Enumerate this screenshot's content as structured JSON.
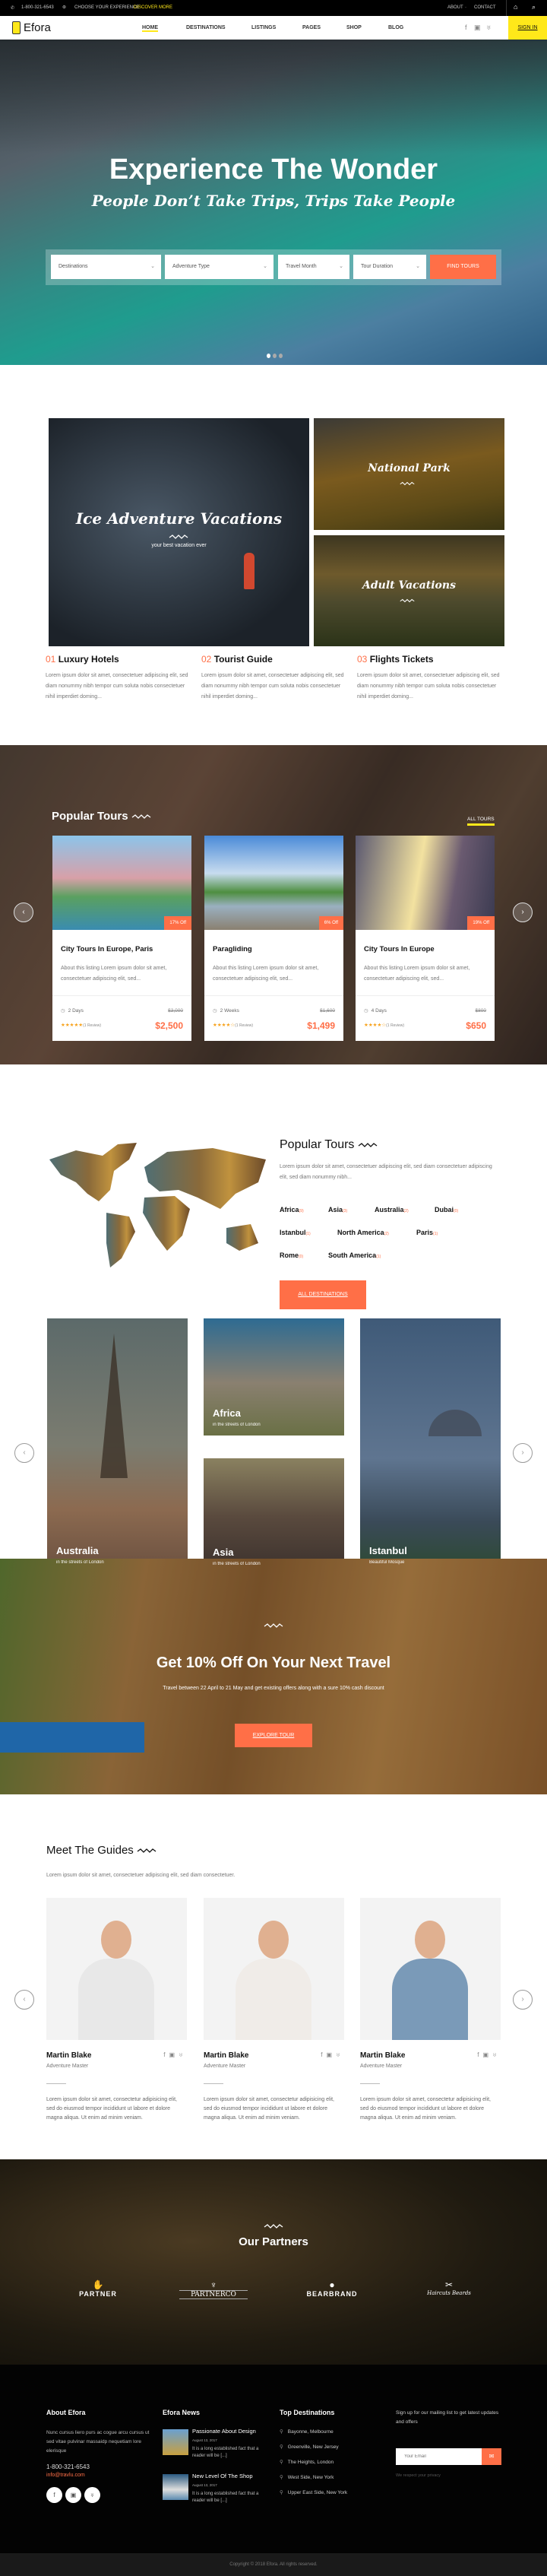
{
  "topbar": {
    "phone": "1-800-321-6543",
    "experience": "CHOOSE YOUR EXPERIENCE",
    "discover": "DISCOVER MORE",
    "about": "ABOUT",
    "contact": "CONTACT"
  },
  "nav": {
    "logo": "Efora",
    "items": [
      "HOME",
      "DESTINATIONS",
      "LISTINGS",
      "PAGES",
      "SHOP",
      "BLOG"
    ],
    "active": "HOME",
    "sign_in": "SIGN IN"
  },
  "hero": {
    "title": "Experience The Wonder",
    "subtitle": "People Don’t Take Trips, Trips Take People",
    "search": {
      "destinations": "Destinations",
      "adventure": "Adventure Type",
      "month": "Travel Month",
      "duration": "Tour Duration",
      "button": "FIND TOURS"
    },
    "slides": 3,
    "active_slide": 1
  },
  "categories": [
    {
      "title": "Ice Adventure Vacations",
      "subtitle": "your best vacation ever"
    },
    {
      "title": "National Park"
    },
    {
      "title": "Adult Vacations"
    }
  ],
  "features": [
    {
      "num": "01",
      "title": "Luxury Hotels",
      "text": "Lorem ipsum dolor sit amet, consectetuer adipiscing elit, sed diam nonummy nibh tempor cum soluta nobis consectetuer nihil imperdiet doming..."
    },
    {
      "num": "02",
      "title": "Tourist Guide",
      "text": "Lorem ipsum dolor sit amet, consectetuer adipiscing elit, sed diam nonummy nibh tempor cum soluta nobis consectetuer nihil imperdiet doming..."
    },
    {
      "num": "03",
      "title": "Flights Tickets",
      "text": "Lorem ipsum dolor sit amet, consectetuer adipiscing elit, sed diam nonummy nibh tempor cum soluta nobis consectetuer nihil imperdiet doming..."
    }
  ],
  "tours": {
    "title": "Popular Tours",
    "all": "ALL TOURS",
    "items": [
      {
        "discount": "17% Off",
        "title": "City Tours In Europe, Paris",
        "desc": "About this listing Lorem ipsum dolor sit amet, consectetuer adipiscing elit, sed...",
        "duration": "2 Days",
        "rating": 5,
        "reviews": "(1 Review)",
        "old_price": "$3,000",
        "price": "$2,500"
      },
      {
        "discount": "6% Off",
        "title": "Paragliding",
        "desc": "About this listing Lorem ipsum dolor sit amet, consectetuer adipiscing elit, sed...",
        "duration": "2 Weeks",
        "rating": 4,
        "reviews": "(1 Review)",
        "old_price": "$1,600",
        "price": "$1,499"
      },
      {
        "discount": "19% Off",
        "title": "City Tours In Europe",
        "desc": "About this listing Lorem ipsum dolor sit amet, consectetuer adipiscing elit, sed...",
        "duration": "4 Days",
        "rating": 4,
        "reviews": "(1 Review)",
        "old_price": "$800",
        "price": "$650"
      }
    ]
  },
  "map_tours": {
    "title": "Popular Tours",
    "text": "Lorem ipsum dolor sit amet, consectetuer adipiscing elit, sed diam consectetuer adipiscing elit, sed diam nonummy nibh...",
    "destinations": [
      {
        "name": "Africa",
        "count": "(9)"
      },
      {
        "name": "Asia",
        "count": "(3)"
      },
      {
        "name": "Australia",
        "count": "(2)"
      },
      {
        "name": "Dubai",
        "count": "(0)"
      },
      {
        "name": "Istanbul",
        "count": "(1)"
      },
      {
        "name": "North America",
        "count": "(2)"
      },
      {
        "name": "Paris",
        "count": "(1)"
      },
      {
        "name": "Rome",
        "count": "(0)"
      },
      {
        "name": "South America",
        "count": "(1)"
      }
    ],
    "button": "ALL DESTINATIONS"
  },
  "dest_tiles": [
    {
      "name": "Australia",
      "sub": "in the streets of London"
    },
    {
      "name": "Africa",
      "sub": "in the streets of London"
    },
    {
      "name": "Asia",
      "sub": "in the streets of London"
    },
    {
      "name": "Istanbul",
      "sub": "Beautiful Mosque"
    }
  ],
  "promo": {
    "title": "Get 10% Off On Your Next Travel",
    "text": "Travel between 22 April to 21 May and get existing offers along with a sure 10% cash discount",
    "button": "EXPLORE TOUR"
  },
  "guides": {
    "title": "Meet The Guides",
    "text": "Lorem ipsum dolor sit amet, consectetuer adipiscing elit, sed diam consectetuer.",
    "items": [
      {
        "name": "Martin Blake",
        "role": "Adventure Master",
        "bio": "Lorem ipsum dolor sit amet, consectetur adipisicing elit, sed do eiusmod tempor incididunt ut labore et dolore magna aliqua. Ut enim ad minim veniam."
      },
      {
        "name": "Martin Blake",
        "role": "Adventure Master",
        "bio": "Lorem ipsum dolor sit amet, consectetur adipisicing elit, sed do eiusmod tempor incididunt ut labore et dolore magna aliqua. Ut enim ad minim veniam."
      },
      {
        "name": "Martin Blake",
        "role": "Adventure Master",
        "bio": "Lorem ipsum dolor sit amet, consectetur adipisicing elit, sed do eiusmod tempor incididunt ut labore et dolore magna aliqua. Ut enim ad minim veniam."
      }
    ]
  },
  "partners": {
    "title": "Our Partners",
    "logos": [
      "PARTNER",
      "PARTNERCO",
      "BEARBRAND",
      "Haircuts Beards"
    ]
  },
  "footer": {
    "about": {
      "title": "About Efora",
      "text": "Nunc cursus liero purs ac cogue arcu cursus ut sed vitae pulvinar massaidp nequetiam lore elerisque",
      "phone": "1-800-321-6543",
      "email": "info@travlu.com"
    },
    "news": {
      "title": "Efora News",
      "items": [
        {
          "title": "Passionate About Design",
          "date": "August 13, 2017",
          "text": "It is a long established fact that a reader will be [...]"
        },
        {
          "title": "New Level Of The Shop",
          "date": "August 13, 2017",
          "text": "It is a long established fact that a reader will be [...]"
        }
      ]
    },
    "destinations": {
      "title": "Top Destinations",
      "items": [
        "Bayonne, Melbourne",
        "Greenville, New Jersey",
        "The Heights, London",
        "West Side, New York",
        "Upper East Side, New York"
      ]
    },
    "newsletter": {
      "text": "Sign up for our mailing list to get latest updates and offers",
      "placeholder": "Your Email",
      "privacy": "We respect your privacy"
    },
    "copyright": "Copyright © 2018 Efora. All rights reserved."
  },
  "colors": {
    "accent": "#ff6f47",
    "yellow": "#ffe81a",
    "dark": "#030303"
  }
}
